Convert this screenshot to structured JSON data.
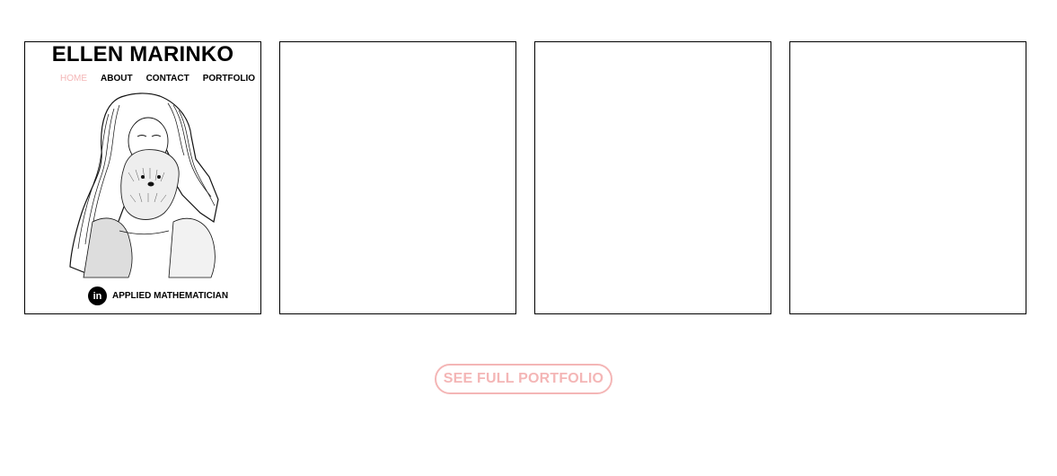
{
  "brand": "ELLEN MARINKO",
  "nav": {
    "home": "HOME",
    "about": "ABOUT",
    "contact": "CONTACT",
    "portfolio": "PORTFOLIO"
  },
  "footer": {
    "linkedin_icon_text": "in",
    "title": "APPLIED MATHEMATICIAN"
  },
  "cta": "SEE FULL PORTFOLIO",
  "colors": {
    "accent": "#f4b6b6",
    "border": "#000000",
    "background": "#ffffff"
  }
}
